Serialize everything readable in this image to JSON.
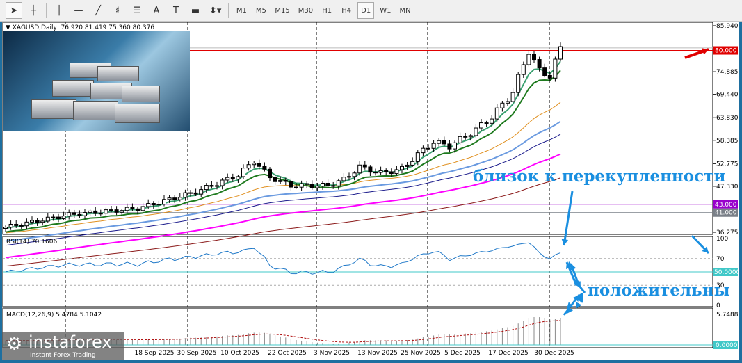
{
  "toolbar": {
    "tools": [
      "cursor-tool",
      "crosshair-tool",
      "vertical-line-tool",
      "horizontal-line-tool",
      "trendline-tool",
      "fibonacci-tool",
      "channel-tool",
      "text-tool",
      "label-tool",
      "rectangle-tool",
      "arrows-tool"
    ],
    "timeframes": [
      "M1",
      "M5",
      "M15",
      "M30",
      "H1",
      "H4",
      "D1",
      "W1",
      "MN"
    ],
    "active_timeframe": "D1",
    "text_A": "A",
    "text_T": "T"
  },
  "header": {
    "symbol": "XAGUSD,Daily",
    "ohlc": "76.920 81.419 75.360 80.376"
  },
  "price_axis": [
    "85.940",
    "74.885",
    "69.440",
    "63.830",
    "58.385",
    "52.775",
    "47.330",
    "36.275"
  ],
  "levels": [
    {
      "label": "80.000",
      "color": "#e00000"
    },
    {
      "label": "43.000",
      "color": "#9900cc"
    },
    {
      "label": "41.000",
      "color": "#7a8088"
    }
  ],
  "rsi": {
    "label": "RSI(14) 70.1606",
    "axis": [
      "100",
      "70",
      "30",
      "0"
    ],
    "level": "50.0000"
  },
  "macd": {
    "label": "MACD(12,26,9) 5.4784 5.1042",
    "axis_top": "5.7488",
    "zero": "0.0000"
  },
  "dates": [
    "18 Sep 2025",
    "30 Sep 2025",
    "10 Oct 2025",
    "22 Oct 2025",
    "3 Nov 2025",
    "13 Nov 2025",
    "25 Nov 2025",
    "5 Dec 2025",
    "17 Dec 2025",
    "30 Dec 2025"
  ],
  "annotations": {
    "overbought": "близок к перекупленности",
    "positive": "положительны"
  },
  "logo": {
    "name": "instaforex",
    "tagline": "Instant Forex Trading"
  },
  "chart_data": {
    "type": "candlestick",
    "price_range": [
      36.275,
      85.94
    ],
    "close_keypoints": [
      [
        0,
        37.5
      ],
      [
        12,
        40.5
      ],
      [
        25,
        42
      ],
      [
        36,
        46
      ],
      [
        44,
        50
      ],
      [
        47,
        53.5
      ],
      [
        50,
        49.5
      ],
      [
        54,
        47.5
      ],
      [
        61,
        47.5
      ],
      [
        64,
        49
      ],
      [
        67,
        52
      ],
      [
        71,
        50.5
      ],
      [
        75,
        51.5
      ],
      [
        78,
        55
      ],
      [
        81,
        58
      ],
      [
        84,
        57
      ],
      [
        89,
        61
      ],
      [
        92,
        64
      ],
      [
        96,
        70
      ],
      [
        99,
        80
      ],
      [
        101,
        75
      ],
      [
        103,
        74
      ],
      [
        105,
        80.4
      ]
    ]
  }
}
